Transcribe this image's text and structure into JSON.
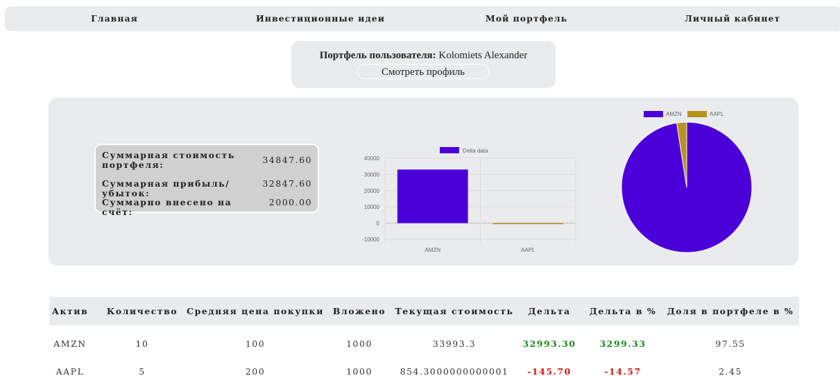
{
  "nav": {
    "items": [
      "Главная",
      "Инвестиционные идеи",
      "Мой портфель",
      "Личный кабинет"
    ]
  },
  "user": {
    "label": "Портфель пользователя:",
    "name": "Kolomiets Alexander",
    "profile_button": "Смотреть профиль"
  },
  "summary": {
    "rows": [
      {
        "label": "Суммарная стоимость портфеля:",
        "value": "34847.60"
      },
      {
        "label": "Суммарная прибыль/убыток:",
        "value": "32847.60"
      },
      {
        "label": "Суммарно внесено на счёт:",
        "value": "2000.00"
      }
    ]
  },
  "colors": {
    "amzn": "#4b00d9",
    "aapl": "#b8921a",
    "positive": "#1a8a1a",
    "negative": "#d41414",
    "panel": "#e9ebec"
  },
  "chart_data": [
    {
      "type": "bar",
      "categories": [
        "AMZN",
        "AAPL"
      ],
      "series": [
        {
          "name": "Delta data",
          "values": [
            32993.3,
            -145.7
          ]
        }
      ],
      "ylim": [
        -10000,
        40000
      ],
      "yticks": [
        "40000",
        "30000",
        "20000",
        "10000",
        "0",
        "-10000"
      ],
      "legend": "top",
      "grid": true
    },
    {
      "type": "pie",
      "labels": [
        "AMZN",
        "AAPL"
      ],
      "values": [
        97.55,
        2.45
      ],
      "legend": "top"
    }
  ],
  "table": {
    "headers": [
      "Актив",
      "Количество",
      "Средняя цена покупки",
      "Вложено",
      "Текущая стоимость",
      "Дельта",
      "Дельта в %",
      "Доля в портфеле в %"
    ],
    "rows": [
      {
        "asset": "AMZN",
        "qty": "10",
        "avg_price": "100",
        "invested": "1000",
        "current": "33993.3",
        "delta": "32993.30",
        "delta_pct": "3299.33",
        "share": "97.55",
        "sign": "pos"
      },
      {
        "asset": "AAPL",
        "qty": "5",
        "avg_price": "200",
        "invested": "1000",
        "current": "854.3000000000001",
        "delta": "-145.70",
        "delta_pct": "-14.57",
        "share": "2.45",
        "sign": "neg"
      }
    ]
  }
}
